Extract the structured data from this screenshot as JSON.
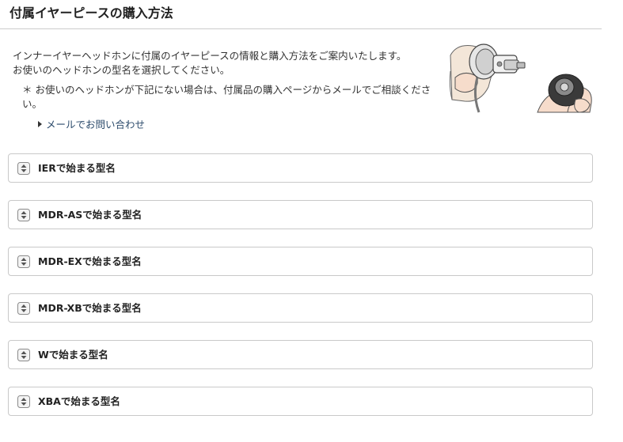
{
  "page": {
    "title": "付属イヤーピースの購入方法"
  },
  "intro": {
    "line1": "インナーイヤーヘッドホンに付属のイヤーピースの情報と購入方法をご案内いたします。",
    "line2": "お使いのヘッドホンの型名を選択してください。",
    "note": "＊ お使いのヘッドホンが下記にない場合は、付属品の購入ページからメールでご相談ください。",
    "contact_link": "メールでお問い合わせ"
  },
  "accordions": [
    {
      "label": "IERで始まる型名"
    },
    {
      "label": "MDR-ASで始まる型名"
    },
    {
      "label": "MDR-EXで始まる型名"
    },
    {
      "label": "MDR-XBで始まる型名"
    },
    {
      "label": "Wで始まる型名"
    },
    {
      "label": "XBAで始まる型名"
    }
  ],
  "icons": {
    "toggle": "expand-collapse-icon",
    "link_arrow": "triangle-right-icon",
    "illustration": "earpiece-illustration"
  },
  "colors": {
    "link": "#2b4a6b",
    "border": "#c9c9c9"
  }
}
